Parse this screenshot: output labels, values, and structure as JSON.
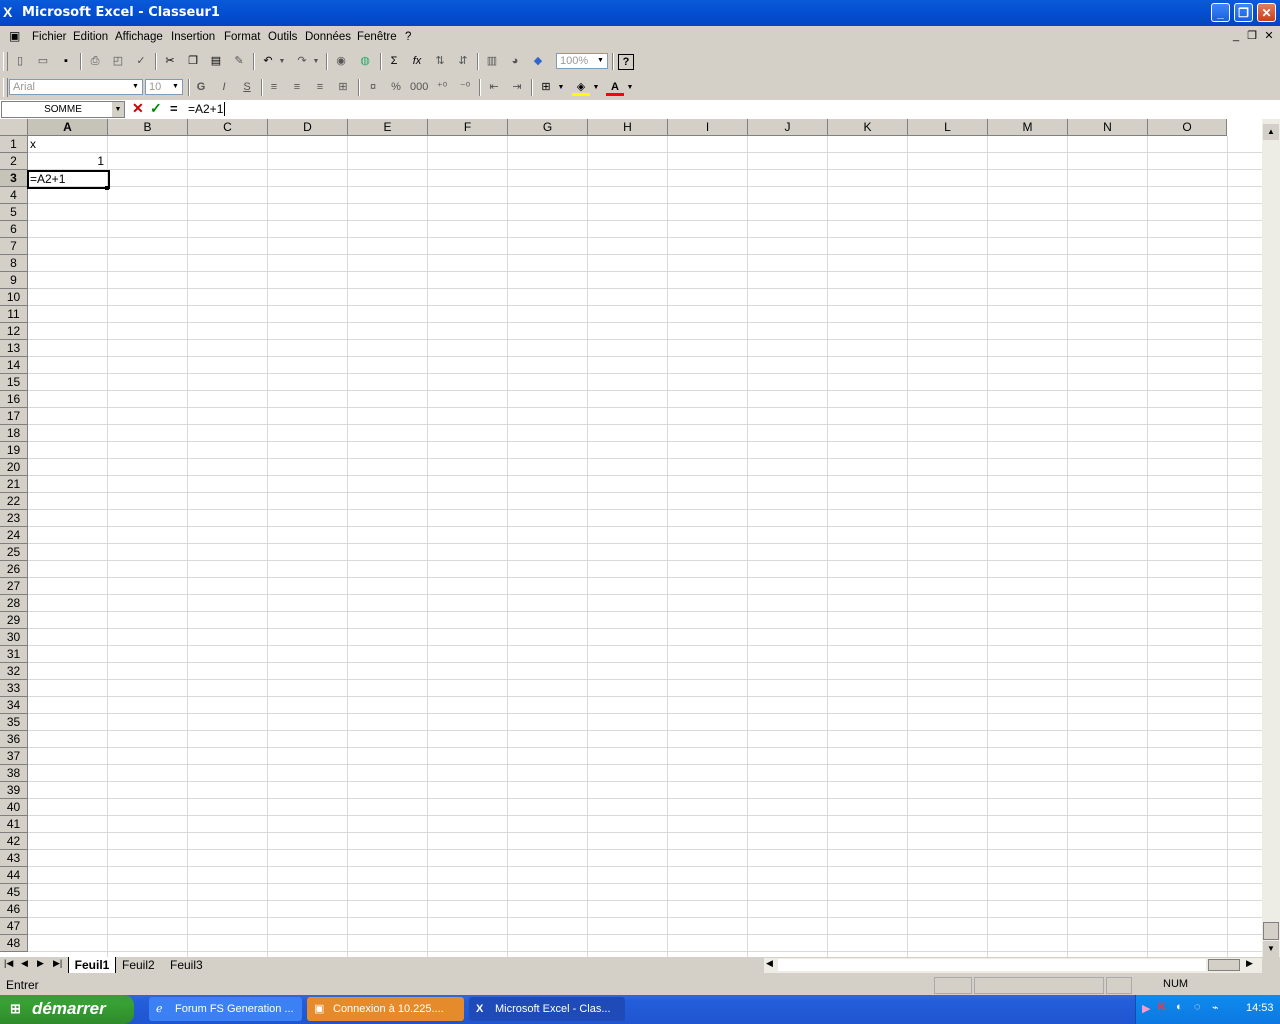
{
  "window": {
    "title": "Microsoft Excel - Classeur1",
    "min": "_",
    "max": "❐",
    "close": "✕"
  },
  "menu": [
    "Fichier",
    "Edition",
    "Affichage",
    "Insertion",
    "Format",
    "Outils",
    "Données",
    "Fenêtre",
    "?"
  ],
  "toolbar": {
    "zoom": "100%",
    "font": "Arial",
    "size": "10",
    "bold": "G",
    "italic": "I",
    "underline": "S",
    "sum": "Σ",
    "fx": "fx"
  },
  "formula_bar": {
    "namebox": "SOMME",
    "cancel": "✕",
    "enter": "✓",
    "equals": "=",
    "content": "=A2+1"
  },
  "columns": [
    "A",
    "B",
    "C",
    "D",
    "E",
    "F",
    "G",
    "H",
    "I",
    "J",
    "K",
    "L",
    "M",
    "N",
    "O"
  ],
  "rows": [
    "1",
    "2",
    "3",
    "4",
    "5",
    "6",
    "7",
    "8",
    "9",
    "10",
    "11",
    "12",
    "13",
    "14",
    "15",
    "16",
    "17",
    "18",
    "19",
    "20",
    "21",
    "22",
    "23",
    "24",
    "25",
    "26",
    "27",
    "28",
    "29",
    "30",
    "31",
    "32",
    "33",
    "34",
    "35",
    "36",
    "37",
    "38",
    "39",
    "40",
    "41",
    "42",
    "43",
    "44",
    "45",
    "46",
    "47",
    "48"
  ],
  "cells": {
    "A1": "x",
    "A2": "1",
    "A3": "=A2+1"
  },
  "sheets": [
    "Feuil1",
    "Feuil2",
    "Feuil3"
  ],
  "status": {
    "mode": "Entrer",
    "num": "NUM"
  },
  "taskbar": {
    "start": "démarrer",
    "tasks": [
      "Forum FS Generation ...",
      "Connexion à 10.225....",
      "Microsoft Excel - Clas..."
    ],
    "clock": "14:53"
  },
  "colors": {
    "titlebar": "#0550d3",
    "taskbar": "#245edb",
    "start": "#37a133",
    "tray": "#0f8bee"
  }
}
